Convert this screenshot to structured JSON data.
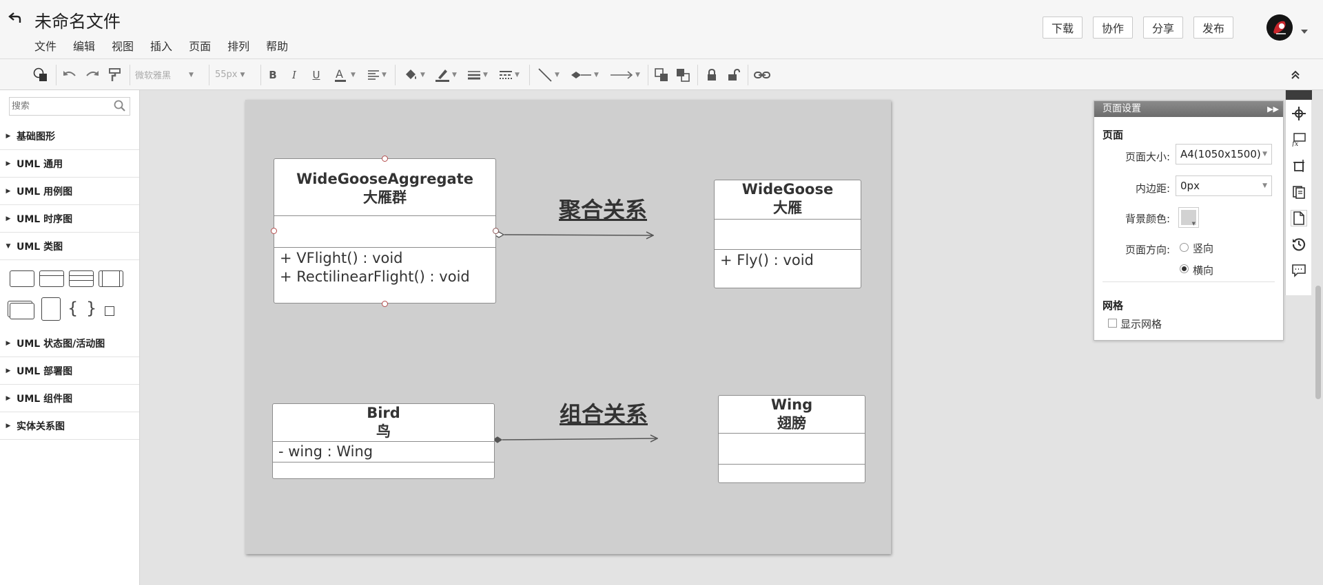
{
  "header": {
    "title": "未命名文件",
    "menu": [
      "文件",
      "编辑",
      "视图",
      "插入",
      "页面",
      "排列",
      "帮助"
    ],
    "actions": [
      "下载",
      "协作",
      "分享",
      "发布"
    ]
  },
  "toolbar": {
    "font_family": "微软雅黑",
    "font_size": "55px"
  },
  "sidebar": {
    "search_placeholder": "搜索",
    "libraries": [
      {
        "label": "基础图形",
        "expanded": false
      },
      {
        "label": "UML 通用",
        "expanded": false
      },
      {
        "label": "UML 用例图",
        "expanded": false
      },
      {
        "label": "UML 时序图",
        "expanded": false
      },
      {
        "label": "UML 类图",
        "expanded": true
      },
      {
        "label": "UML 状态图/活动图",
        "expanded": false
      },
      {
        "label": "UML 部署图",
        "expanded": false
      },
      {
        "label": "UML 组件图",
        "expanded": false
      },
      {
        "label": "实体关系图",
        "expanded": false
      }
    ]
  },
  "diagram": {
    "classes": {
      "aggregate": {
        "name": "WideGooseAggregate",
        "cn": "大雁群",
        "attributes": [],
        "methods": [
          "+ VFlight() : void",
          "+ RectilinearFlight() : void"
        ]
      },
      "goose": {
        "name": "WideGoose",
        "cn": "大雁",
        "attributes": [],
        "methods": [
          "+ Fly() : void"
        ]
      },
      "bird": {
        "name": "Bird",
        "cn": "鸟",
        "attributes": [
          "- wing : Wing"
        ],
        "methods": []
      },
      "wing": {
        "name": "Wing",
        "cn": "翅膀",
        "attributes": [],
        "methods": []
      }
    },
    "relations": {
      "aggregation_label": "聚合关系",
      "composition_label": "组合关系"
    }
  },
  "page_settings": {
    "title": "页面设置",
    "section_page": "页面",
    "page_size_label": "页面大小:",
    "page_size_value": "A4(1050x1500)",
    "padding_label": "内边距:",
    "padding_value": "0px",
    "bg_color_label": "背景颜色:",
    "bg_color": "#d2d2d2",
    "orientation_label": "页面方向:",
    "orientation_portrait": "竖向",
    "orientation_landscape": "横向",
    "orientation_selected": "横向",
    "section_grid": "网格",
    "show_grid_label": "显示网格",
    "show_grid": false
  },
  "colors": {
    "canvas_bg": "#e3e3e3",
    "page_bg": "#cfcfcf",
    "uml_border": "#8c8c8c",
    "handle": "#b34b4b",
    "connector": "#555555"
  }
}
